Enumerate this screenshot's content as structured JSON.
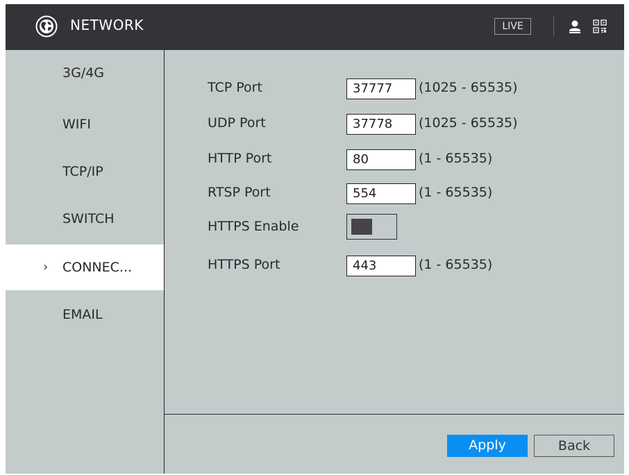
{
  "header": {
    "title": "NETWORK",
    "live_label": "LIVE"
  },
  "sidebar": {
    "items": [
      {
        "label": "3G/4G"
      },
      {
        "label": "WIFI"
      },
      {
        "label": "TCP/IP"
      },
      {
        "label": "SWITCH"
      },
      {
        "label": "CONNEC...",
        "active": true,
        "chevron": "›"
      },
      {
        "label": "EMAIL"
      }
    ]
  },
  "form": {
    "rows": [
      {
        "label": "TCP Port",
        "value": "37777",
        "range": "(1025 - 65535)"
      },
      {
        "label": "UDP Port",
        "value": "37778",
        "range": "(1025 - 65535)"
      },
      {
        "label": "HTTP Port",
        "value": "80",
        "range": "(1 - 65535)"
      },
      {
        "label": "RTSP Port",
        "value": "554",
        "range": "(1 - 65535)"
      },
      {
        "label": "HTTPS Enable"
      },
      {
        "label": "HTTPS Port",
        "value": "443",
        "range": "(1 - 65535)"
      }
    ],
    "https_enabled": false
  },
  "footer": {
    "apply_label": "Apply",
    "back_label": "Back"
  },
  "colors": {
    "titlebar": "#333338",
    "background": "#c3cbcb",
    "accent": "#0a8ff0"
  },
  "icons": [
    "globe-icon",
    "user-icon",
    "qr-code-icon",
    "chevron-right-icon"
  ]
}
